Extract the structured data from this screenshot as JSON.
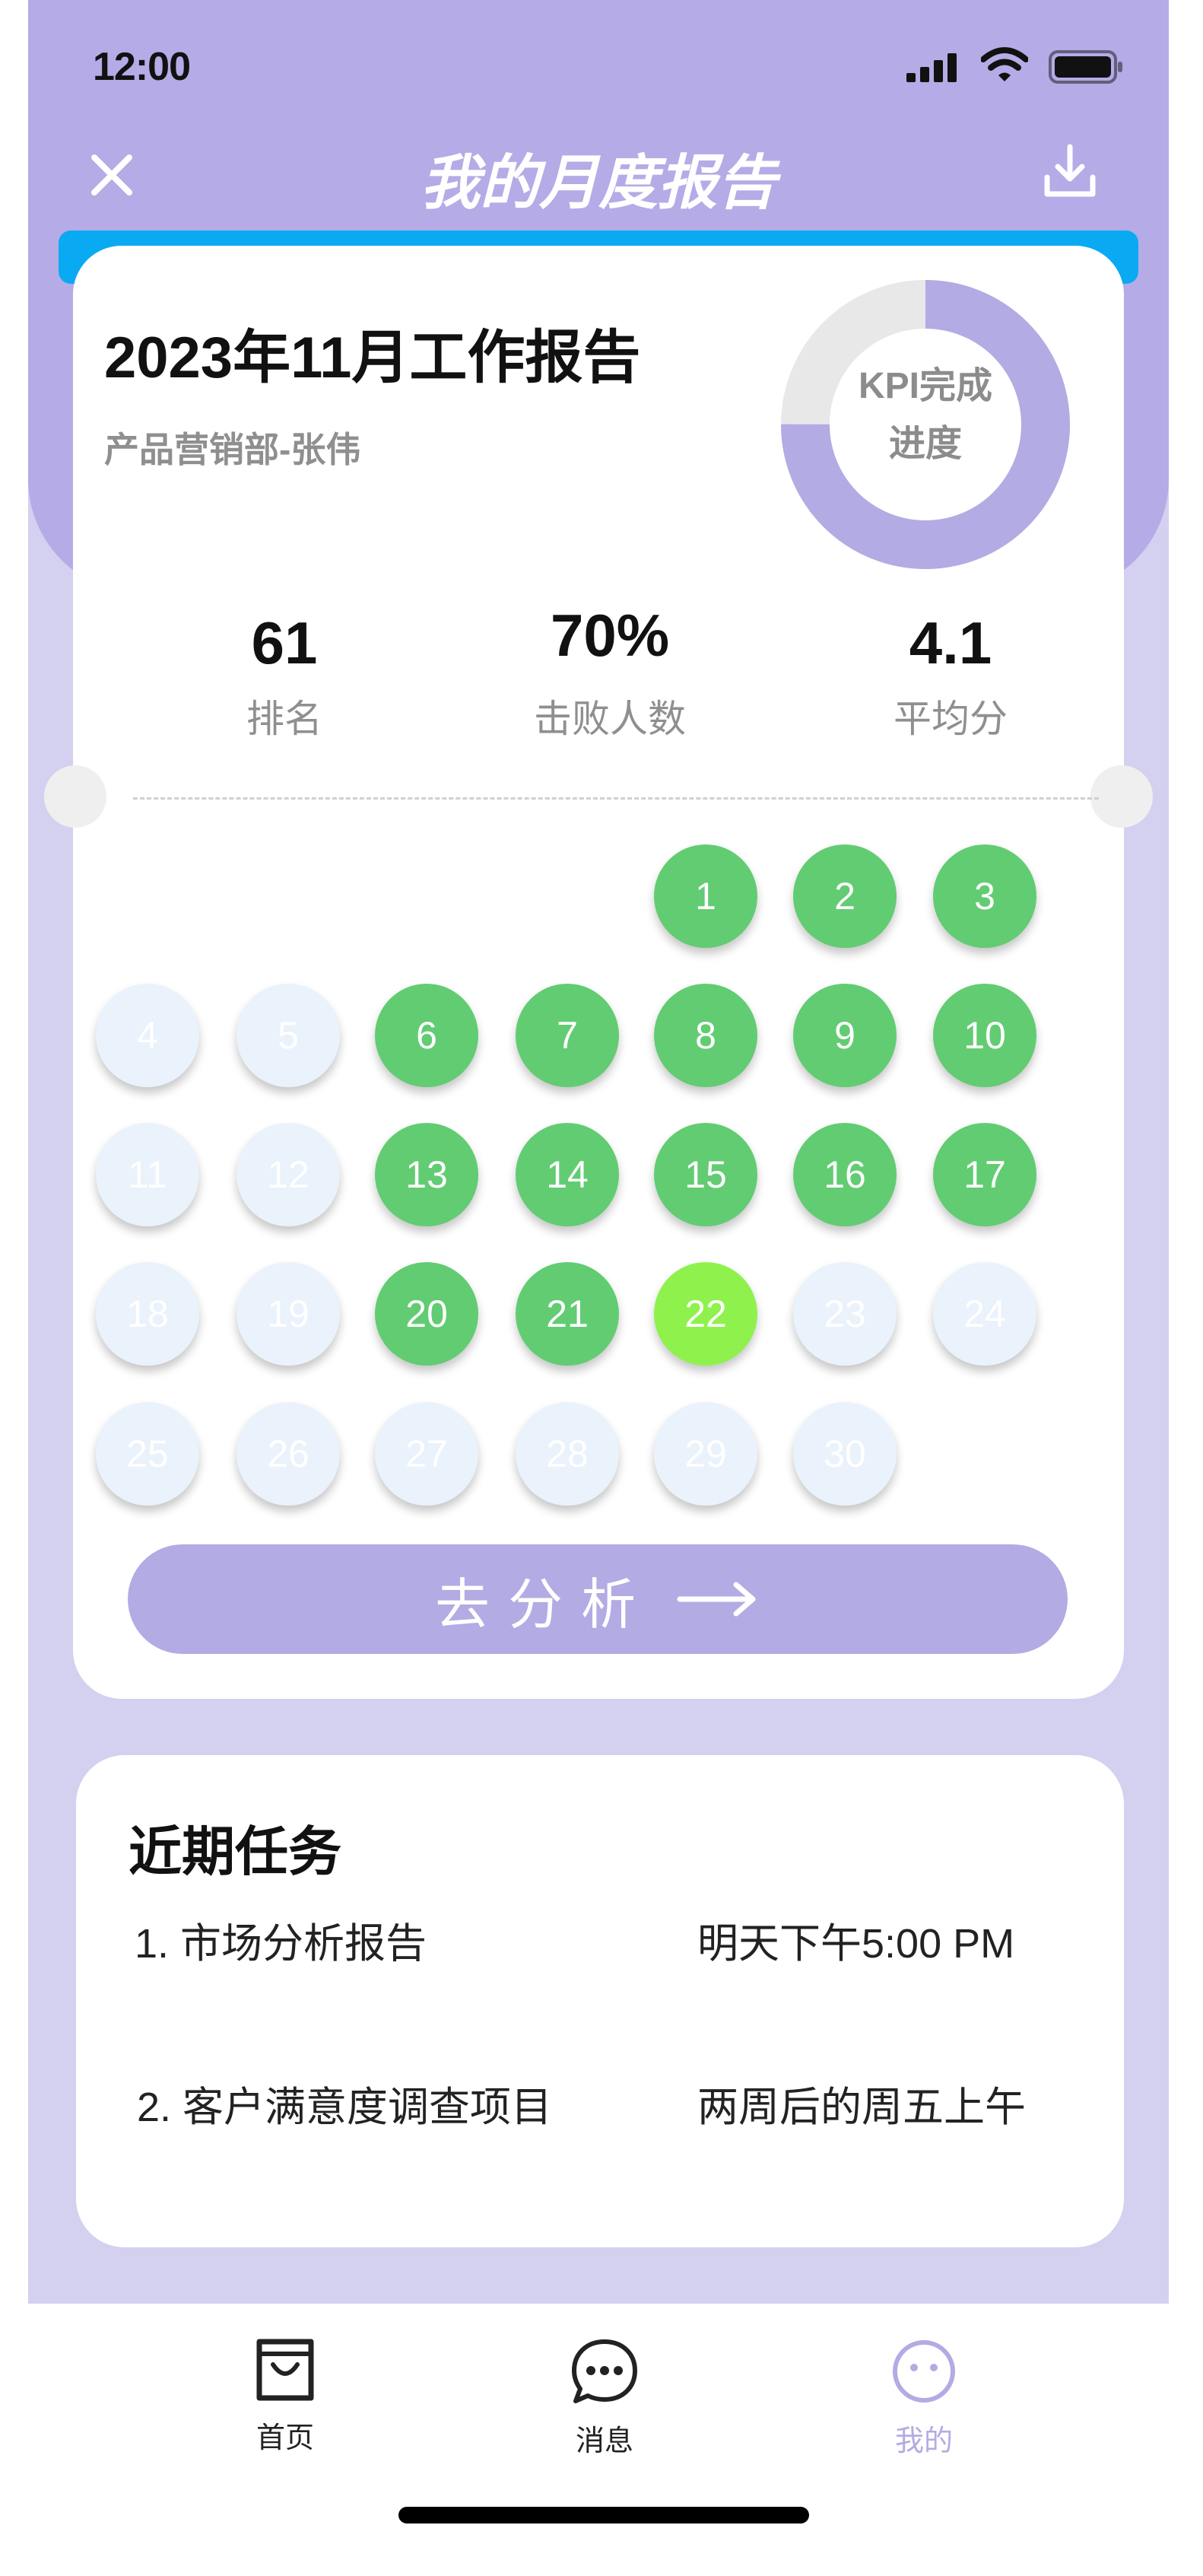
{
  "status": {
    "time": "12:00"
  },
  "nav": {
    "title": "我的月度报告"
  },
  "report": {
    "title": "2023年11月工作报告",
    "subtitle": "产品营销部-张伟",
    "kpi_label_line1": "KPI完成",
    "kpi_label_line2": "进度",
    "kpi_progress": 0.75,
    "stats": [
      {
        "value": "61",
        "label": "排名"
      },
      {
        "value": "70%",
        "label": "击败人数"
      },
      {
        "value": "4.1",
        "label": "平均分"
      }
    ]
  },
  "calendar": {
    "days": [
      {
        "n": "1",
        "s": "done"
      },
      {
        "n": "2",
        "s": "done"
      },
      {
        "n": "3",
        "s": "done"
      },
      {
        "n": "4",
        "s": "future"
      },
      {
        "n": "5",
        "s": "future"
      },
      {
        "n": "6",
        "s": "done"
      },
      {
        "n": "7",
        "s": "done"
      },
      {
        "n": "8",
        "s": "done"
      },
      {
        "n": "9",
        "s": "done"
      },
      {
        "n": "10",
        "s": "done"
      },
      {
        "n": "11",
        "s": "future"
      },
      {
        "n": "12",
        "s": "future"
      },
      {
        "n": "13",
        "s": "done"
      },
      {
        "n": "14",
        "s": "done"
      },
      {
        "n": "15",
        "s": "done"
      },
      {
        "n": "16",
        "s": "done"
      },
      {
        "n": "17",
        "s": "done"
      },
      {
        "n": "18",
        "s": "future"
      },
      {
        "n": "19",
        "s": "future"
      },
      {
        "n": "20",
        "s": "done"
      },
      {
        "n": "21",
        "s": "done"
      },
      {
        "n": "22",
        "s": "today"
      },
      {
        "n": "23",
        "s": "future"
      },
      {
        "n": "24",
        "s": "future"
      },
      {
        "n": "25",
        "s": "future"
      },
      {
        "n": "26",
        "s": "future"
      },
      {
        "n": "27",
        "s": "future"
      },
      {
        "n": "28",
        "s": "future"
      },
      {
        "n": "29",
        "s": "future"
      },
      {
        "n": "30",
        "s": "future"
      }
    ]
  },
  "analyze_button": {
    "label": "去分析"
  },
  "tasks": {
    "heading": "近期任务",
    "items": [
      {
        "name": "1. 市场分析报告",
        "due": "明天下午5:00 PM"
      },
      {
        "name": "2. 客户满意度调查项目",
        "due": "两周后的周五上午"
      }
    ]
  },
  "tabbar": {
    "home": "首页",
    "messages": "消息",
    "mine": "我的"
  },
  "colors": {
    "accent": "#b3abe3",
    "done": "#62cc72",
    "today": "#8ff24c",
    "future": "#eaf2fb",
    "topbar": "#0aaaf2"
  }
}
